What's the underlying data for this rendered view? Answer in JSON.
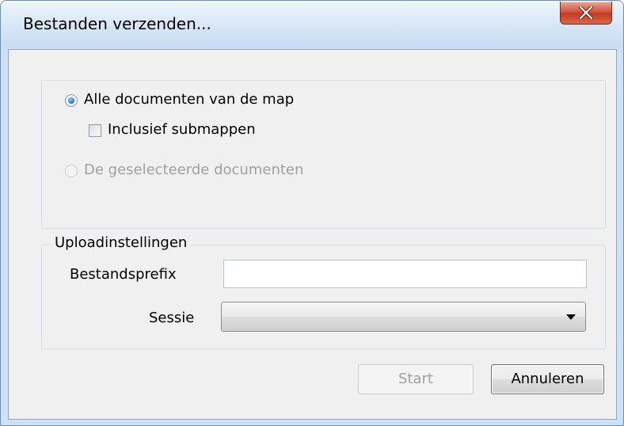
{
  "window": {
    "title": "Bestanden verzenden..."
  },
  "scope": {
    "all_docs_label": "Alle documenten van de map",
    "all_docs_selected": true,
    "include_subfolders_label": "Inclusief submappen",
    "include_subfolders_checked": false,
    "selected_docs_label": "De geselecteerde documenten",
    "selected_docs_enabled": false
  },
  "upload": {
    "group_label": "Uploadinstellingen",
    "prefix_label": "Bestandsprefix",
    "prefix_value": "",
    "session_label": "Sessie",
    "session_value": ""
  },
  "buttons": {
    "start_label": "Start",
    "start_enabled": false,
    "cancel_label": "Annuleren"
  },
  "icons": {
    "close": "close-icon",
    "dropdown": "chevron-down-icon"
  }
}
